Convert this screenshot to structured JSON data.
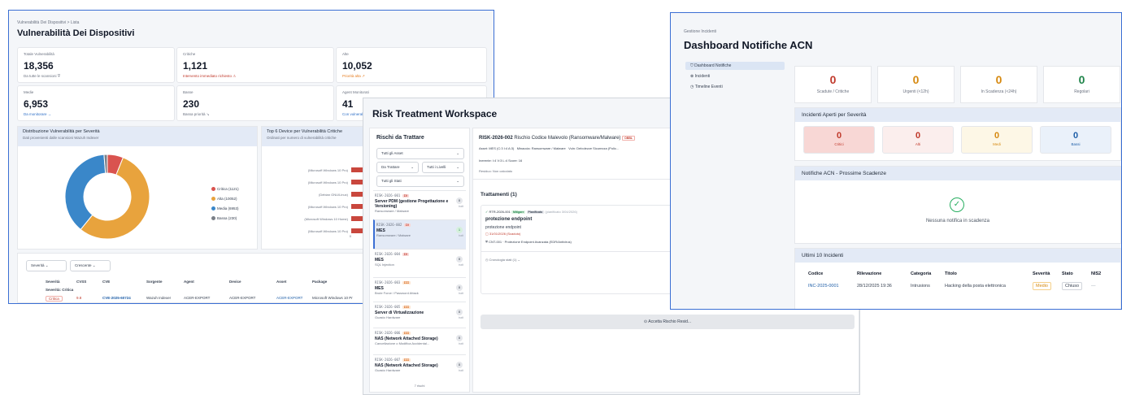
{
  "w1": {
    "breadcrumb": "Vulnerabilità Dei Dispositivi  >  Lista",
    "title": "Vulnerabilità Dei Dispositivi",
    "stats": [
      {
        "label": "Totale Vulnerabilità",
        "value": "18,356",
        "sub": "Da tutte le scansioni ⛨"
      },
      {
        "label": "Critiche",
        "value": "1,121",
        "sub": "Intervento immediato richiesto ⚠"
      },
      {
        "label": "Alte",
        "value": "10,052",
        "sub": "Priorità alta ↗"
      },
      {
        "label": "Medie",
        "value": "6,953",
        "sub": "Da monitorare →"
      },
      {
        "label": "Basse",
        "value": "230",
        "sub": "Bassa priorità ↘"
      },
      {
        "label": "Agent Monitorati",
        "value": "41",
        "sub": "Con vulnerab..."
      }
    ],
    "pie_panel": {
      "title": "Distribuzione Vulnerabilità per Severità",
      "subtitle": "Dati provenienti dalle scansioni Wazuh Indexer"
    },
    "bar_panel": {
      "title": "Top 6 Device per Vulnerabilità Critiche",
      "subtitle": "Ordinati per numero di vulnerabilità critiche"
    },
    "filters": {
      "sev": "Severità",
      "order": "Crescente"
    },
    "table_headers": [
      "Severità",
      "CVSS",
      "CVE",
      "Sorgente",
      "Agent",
      "Device",
      "Asset",
      "Package"
    ],
    "group_row": "Severità: Critica",
    "row": {
      "sev": "Critica",
      "cvss": "9.8",
      "cve": "CVE-2025-60724",
      "source": "Wazuh Indexer",
      "agent": "ACER-EXPORT",
      "device": "ACER-EXPORT",
      "asset": "ACER-EXPORT",
      "package": "Microsoft Windows 10 Pr"
    }
  },
  "chart_data": [
    {
      "type": "pie",
      "title": "Distribuzione Vulnerabilità per Severità",
      "categories": [
        "Critica (1121)",
        "Alta (10052)",
        "Media (6953)",
        "Bassa (230)"
      ],
      "values": [
        1121,
        10052,
        6953,
        230
      ],
      "colors": [
        "#d9534f",
        "#e8a33d",
        "#3a87c9",
        "#7a7f87"
      ]
    },
    {
      "type": "bar",
      "title": "Top 6 Device per Vulnerabilità Critiche",
      "categories": [
        "(Microsoft Windows 10 Pro)",
        "(Microsoft Windows 10 Pro)",
        "(Debian GNU/Linux)",
        "(Microsoft Windows 10 Pro)",
        "(Microsoft Windows 10 Home)",
        "(Microsoft Windows 10 Pro)"
      ],
      "xtick": "0"
    }
  ],
  "w2": {
    "title": "Risk Treatment Workspace",
    "list_title": "Rischi da Trattare",
    "filters": [
      "Tutti gli Asset",
      "Da Trattare",
      "Tutti i Livelli",
      "Tutti gli Stati"
    ],
    "items": [
      {
        "code": "RISK-2026-001",
        "lvl": "IV",
        "name": "Server PDM (gestione Progettazione e Versioning)",
        "cat": "Ransomware / Malware",
        "count": "0",
        "cl": "tratt"
      },
      {
        "code": "RISK-2026-002",
        "lvl": "IV",
        "name": "MES",
        "cat": "Ransomware / Malware",
        "count": "1",
        "cl": "tratt"
      },
      {
        "code": "RISK-2026-004",
        "lvl": "IV",
        "name": "MES",
        "cat": "SQL Injection",
        "count": "0",
        "cl": "tratt"
      },
      {
        "code": "RISK-2026-003",
        "lvl": "III",
        "name": "MES",
        "cat": "Brute Force / Password Attack",
        "count": "0",
        "cl": "tratt"
      },
      {
        "code": "RISK-2026-005",
        "lvl": "III",
        "name": "Server di Virtualizzazione",
        "cat": "Guasto Hardware",
        "count": "0",
        "cl": "tratt"
      },
      {
        "code": "RISK-2026-006",
        "lvl": "III",
        "name": "NAS (Network Attached Storage)",
        "cat": "Cancellazione o Modifica Accidental...",
        "count": "0",
        "cl": "tratt"
      },
      {
        "code": "RISK-2026-007",
        "lvl": "III",
        "name": "NAS (Network Attached Storage)",
        "cat": "Guasto Hardware",
        "count": "0",
        "cl": "tratt"
      }
    ],
    "footer": "7 rischi",
    "detail": {
      "code": "RISK-2026-002",
      "name": "Rischio Codice Malevolo (Ransomware/Malware)",
      "badge": "OBBL",
      "asset": "Asset: MES (C:3 I:4 A:3)",
      "threat": "Minaccia: Ransomware / Malware",
      "vuln": "Vuln: Debolezze Sicurezza (Polic...",
      "inherent": "Inerente: I:4 V:3 L:4 Score: 16",
      "residual": "Residuo: Non calcolato",
      "treat_title": "Trattamenti (1)",
      "treat_code": "RTR-2026-001",
      "treat_type": "Mitigare",
      "treat_state": "Pianificato",
      "treat_date": "(pianificato 3/04/2026)",
      "treat_name": "protezione endpoint",
      "treat_desc": "protezione endpoint",
      "treat_due": "31/01/2026 (Scaduto)",
      "treat_ctrl": "CNT-001 · Protezione Endpoint Avanzata (EDR/Antivirus)",
      "history": "Cronologia stati (1)",
      "accept": "Accetta Rischio Resid..."
    }
  },
  "w3": {
    "breadcrumb": "Gestione Incidenti",
    "title": "Dashboard Notifiche ACN",
    "nav": [
      "Dashboard Notifiche",
      "Incidenti",
      "Timeline Eventi"
    ],
    "kpis": [
      {
        "value": "0",
        "label": "Scadute / Critiche",
        "color": "#c0392b"
      },
      {
        "value": "0",
        "label": "Urgenti (<12h)",
        "color": "#d68910"
      },
      {
        "value": "0",
        "label": "In Scadenza (<24h)",
        "color": "#d68910"
      },
      {
        "value": "0",
        "label": "Regolari",
        "color": "#1e8449"
      }
    ],
    "sev_title": "Incidenti Aperti per Severità",
    "sev": [
      {
        "value": "0",
        "label": "Critici",
        "color": "#c0392b",
        "bg": "#f8d7d5"
      },
      {
        "value": "0",
        "label": "Alti",
        "color": "#c0392b",
        "bg": "#fbeeed"
      },
      {
        "value": "0",
        "label": "Medi",
        "color": "#d68910",
        "bg": "#fdf7e6"
      },
      {
        "value": "0",
        "label": "Bassi",
        "color": "#1f5fa8",
        "bg": "#eaf1fa"
      }
    ],
    "notif_title": "Notifiche ACN - Prossime Scadenze",
    "notif_empty": "Nessuna notifica in scadenza",
    "last_title": "Ultimi 10 Incidenti",
    "headers": [
      "Codice",
      "Rilevazione",
      "Categoria",
      "Titolo",
      "Severità",
      "Stato",
      "NIS2"
    ],
    "row": [
      "INC-2025-0001",
      "28/12/2025 19:36",
      "Intrusions",
      "Hacking della posta elettronica",
      "Medio",
      "Chiuso",
      "—"
    ]
  }
}
